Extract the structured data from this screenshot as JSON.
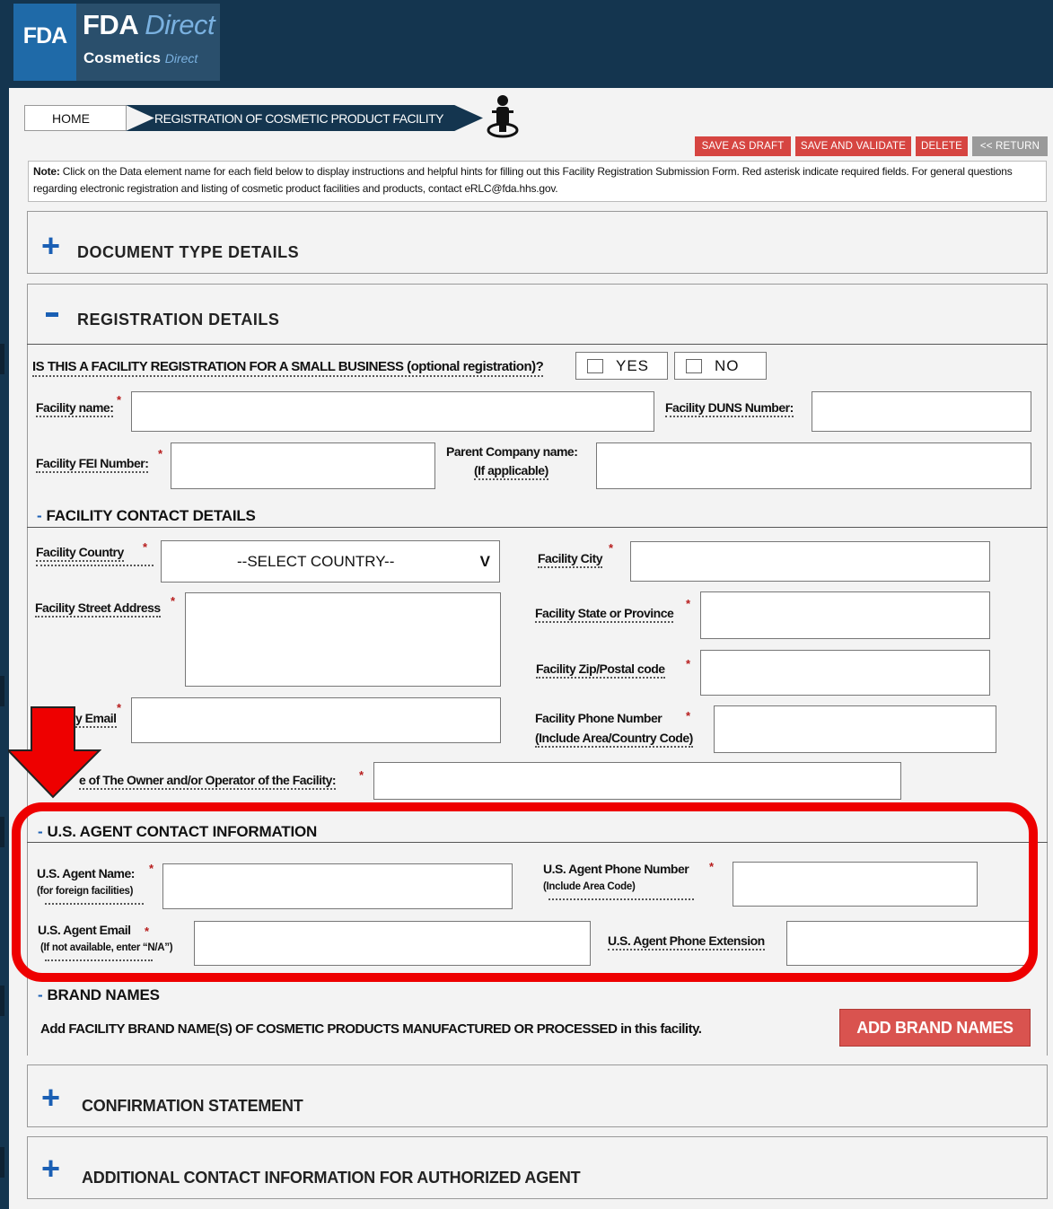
{
  "header": {
    "logo_fda": "FDA",
    "logo_title_bold": "FDA",
    "logo_title_italic": "Direct",
    "logo_sub_bold": "Cosmetics",
    "logo_sub_italic": "Direct"
  },
  "breadcrumb": {
    "home": "HOME",
    "current": "REGISTRATION OF COSMETIC PRODUCT FACILITY"
  },
  "actions": {
    "save_draft": "SAVE AS DRAFT",
    "save_validate": "SAVE AND VALIDATE",
    "delete": "DELETE",
    "return": "<< RETURN"
  },
  "note": {
    "label": "Note:",
    "text": " Click on the Data element name for each field below to display instructions and helpful hints for filling out this Facility Registration Submission Form. Red asterisk indicate required fields. For general questions regarding electronic registration and listing of cosmetic product facilities and products, contact eRLC@fda.hhs.gov."
  },
  "sections": {
    "document_type": {
      "icon": "+",
      "title": "DOCUMENT TYPE DETAILS"
    },
    "registration": {
      "icon": "−",
      "title": "REGISTRATION DETAILS",
      "small_business_question": "IS THIS A FACILITY REGISTRATION FOR A SMALL BUSINESS (optional registration)?",
      "yes": "YES",
      "no": "NO",
      "facility_name": "Facility name:",
      "duns": "Facility DUNS Number:",
      "fei": "Facility FEI Number:",
      "parent_line1": "Parent Company name:",
      "parent_line2": "(If applicable)"
    },
    "facility_contact": {
      "title": "FACILITY CONTACT DETAILS",
      "country": "Facility Country",
      "country_value": "--SELECT COUNTRY--",
      "country_chevron": "V",
      "city": "Facility City",
      "street": "Facility Street Address",
      "state": "Facility State or Province",
      "zip": "Facility Zip/Postal code",
      "email": "y Email",
      "phone_line1": "Facility Phone Number",
      "phone_line2": "(Include Area/Country Code)",
      "owner": "e of The Owner and/or Operator of the Facility:"
    },
    "us_agent": {
      "title": "U.S. AGENT CONTACT INFORMATION",
      "name": "U.S. Agent Name:",
      "name_sub": "(for foreign facilities)",
      "phone": "U.S. Agent Phone Number",
      "phone_sub": "(Include Area Code)",
      "email": "U.S. Agent Email",
      "email_sub": "(If not available, enter “N/A”)",
      "ext": "U.S. Agent Phone Extension"
    },
    "brand_names": {
      "title": "BRAND NAMES",
      "text": "Add FACILITY BRAND NAME(S) OF COSMETIC PRODUCTS MANUFACTURED OR PROCESSED in this facility.",
      "button": "ADD BRAND NAMES"
    },
    "confirmation": {
      "icon": "+",
      "title": "CONFIRMATION STATEMENT"
    },
    "additional": {
      "icon": "+",
      "title": "ADDITIONAL CONTACT INFORMATION FOR AUTHORIZED AGENT"
    }
  },
  "required_mark": "*",
  "subhead_dash": "-",
  "icons": {
    "person": "person-pin-icon",
    "arrow": "red-down-arrow-icon",
    "plus": "plus-icon",
    "minus": "minus-icon"
  },
  "colors": {
    "header": "#14354f",
    "accent_blue": "#1a5fb4",
    "action_red": "#d64541",
    "highlight": "#ee0000"
  }
}
